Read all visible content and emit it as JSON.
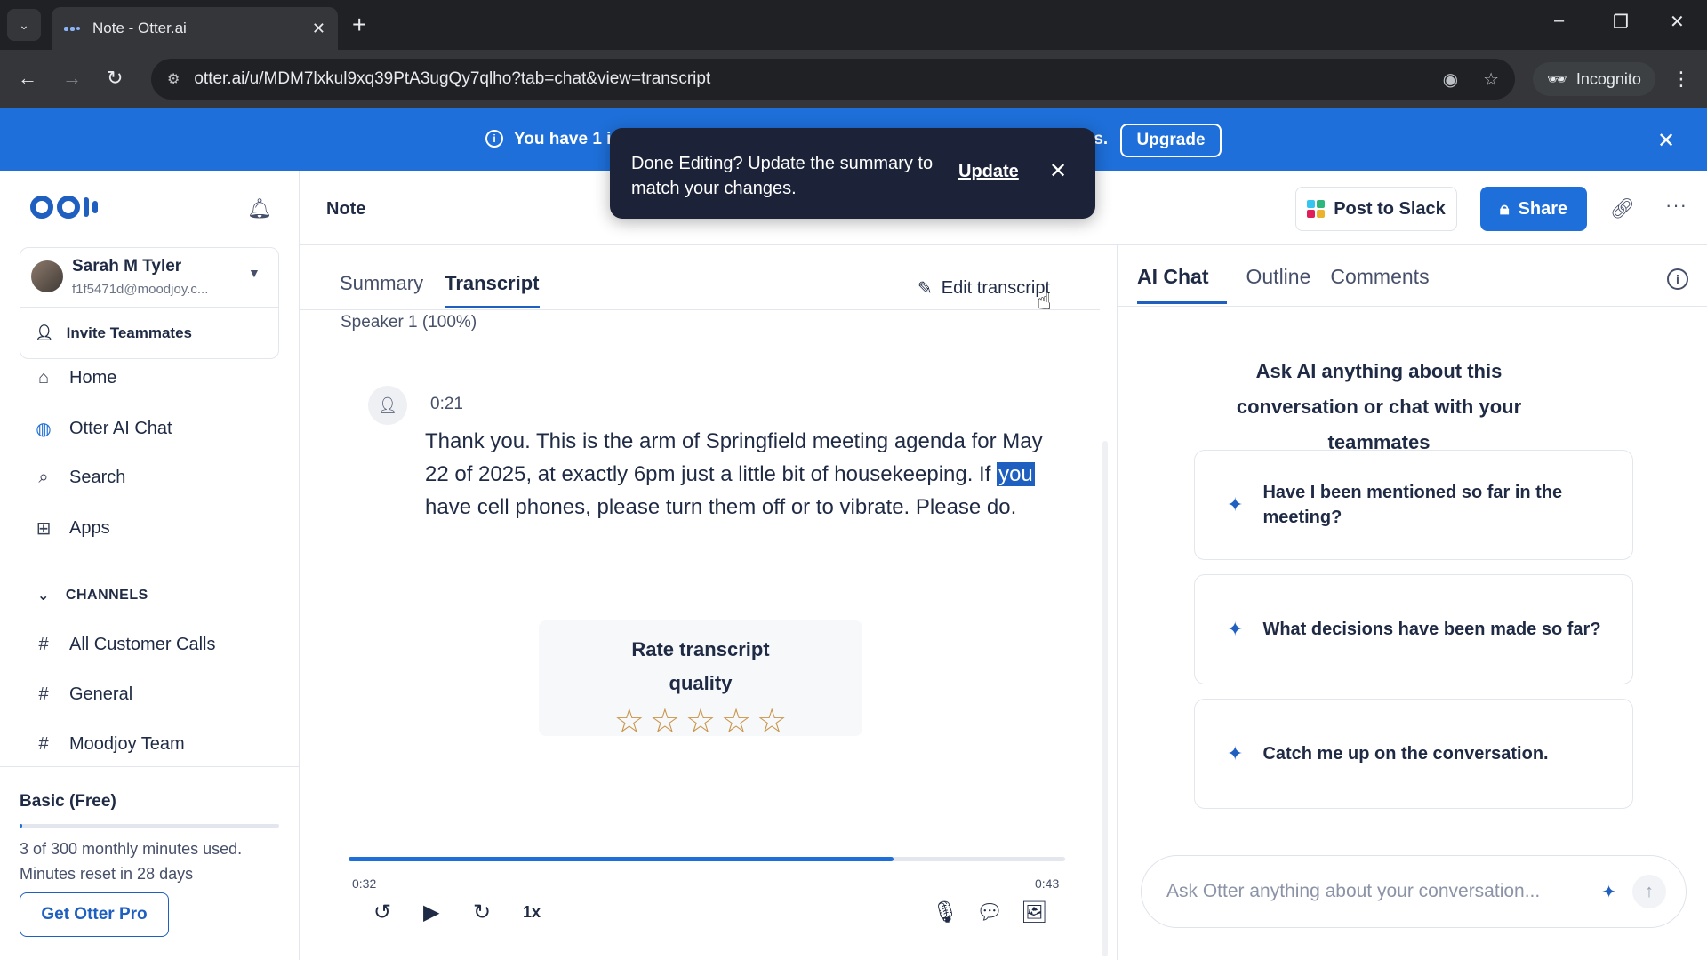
{
  "browser": {
    "tab_title": "Note - Otter.ai",
    "url": "otter.ai/u/MDM7lxkul9xq39PtA3ugQy7qlho?tab=chat&view=transcript",
    "incognito_label": "Incognito"
  },
  "banner": {
    "message_start": "You have 1 i",
    "message_end": "ts.",
    "upgrade_label": "Upgrade"
  },
  "toast": {
    "message": "Done Editing? Update the summary to match your changes.",
    "update_label": "Update"
  },
  "sidebar": {
    "user": {
      "name": "Sarah M Tyler",
      "email": "f1f5471d@moodjoy.c..."
    },
    "invite_label": "Invite Teammates",
    "nav": [
      {
        "label": "Home",
        "icon": "home-icon"
      },
      {
        "label": "Otter AI Chat",
        "icon": "otter-chat-icon"
      },
      {
        "label": "Search",
        "icon": "search-icon"
      },
      {
        "label": "Apps",
        "icon": "apps-icon"
      }
    ],
    "channels_header": "CHANNELS",
    "channels": [
      "All Customer Calls",
      "General",
      "Moodjoy Team"
    ],
    "plan": {
      "name": "Basic (Free)",
      "usage_line1": "3 of 300 monthly minutes used.",
      "usage_line2": "Minutes reset in 28 days",
      "usage_fraction": 0.01,
      "cta": "Get Otter Pro"
    }
  },
  "header": {
    "title": "Note",
    "post_to_slack": "Post to Slack",
    "share": "Share"
  },
  "transcript": {
    "tabs": [
      "Summary",
      "Transcript"
    ],
    "active_tab": "Transcript",
    "edit_label": "Edit transcript",
    "speaker_stat": "Speaker 1 (100%)",
    "utterance": {
      "time": "0:21",
      "text_before": "Thank you. This is the arm of Springfield meeting agenda for May 22 of 2025, at exactly 6pm just a little bit of housekeeping. If ",
      "highlight": "you",
      "text_after": " have cell phones, please turn them off or to vibrate. Please do."
    },
    "rating": {
      "title": "Rate transcript quality",
      "stars": 5,
      "selected": 0
    },
    "player": {
      "current": "0:32",
      "end": "0:43",
      "speed": "1x",
      "progress": 0.76
    }
  },
  "ai_panel": {
    "tabs": [
      "AI Chat",
      "Outline",
      "Comments"
    ],
    "active_tab": "AI Chat",
    "intro": "Ask AI anything about this conversation or chat with your teammates",
    "suggestions": [
      "Have I been mentioned so far in the meeting?",
      "What decisions have been made so far?",
      "Catch me up on the conversation."
    ],
    "input_placeholder": "Ask Otter anything about your conversation..."
  },
  "colors": {
    "brand_blue": "#1e6fd9",
    "otter_navy": "#1e5fbf",
    "toast_bg": "#1c2238",
    "star": "#c8944a"
  }
}
